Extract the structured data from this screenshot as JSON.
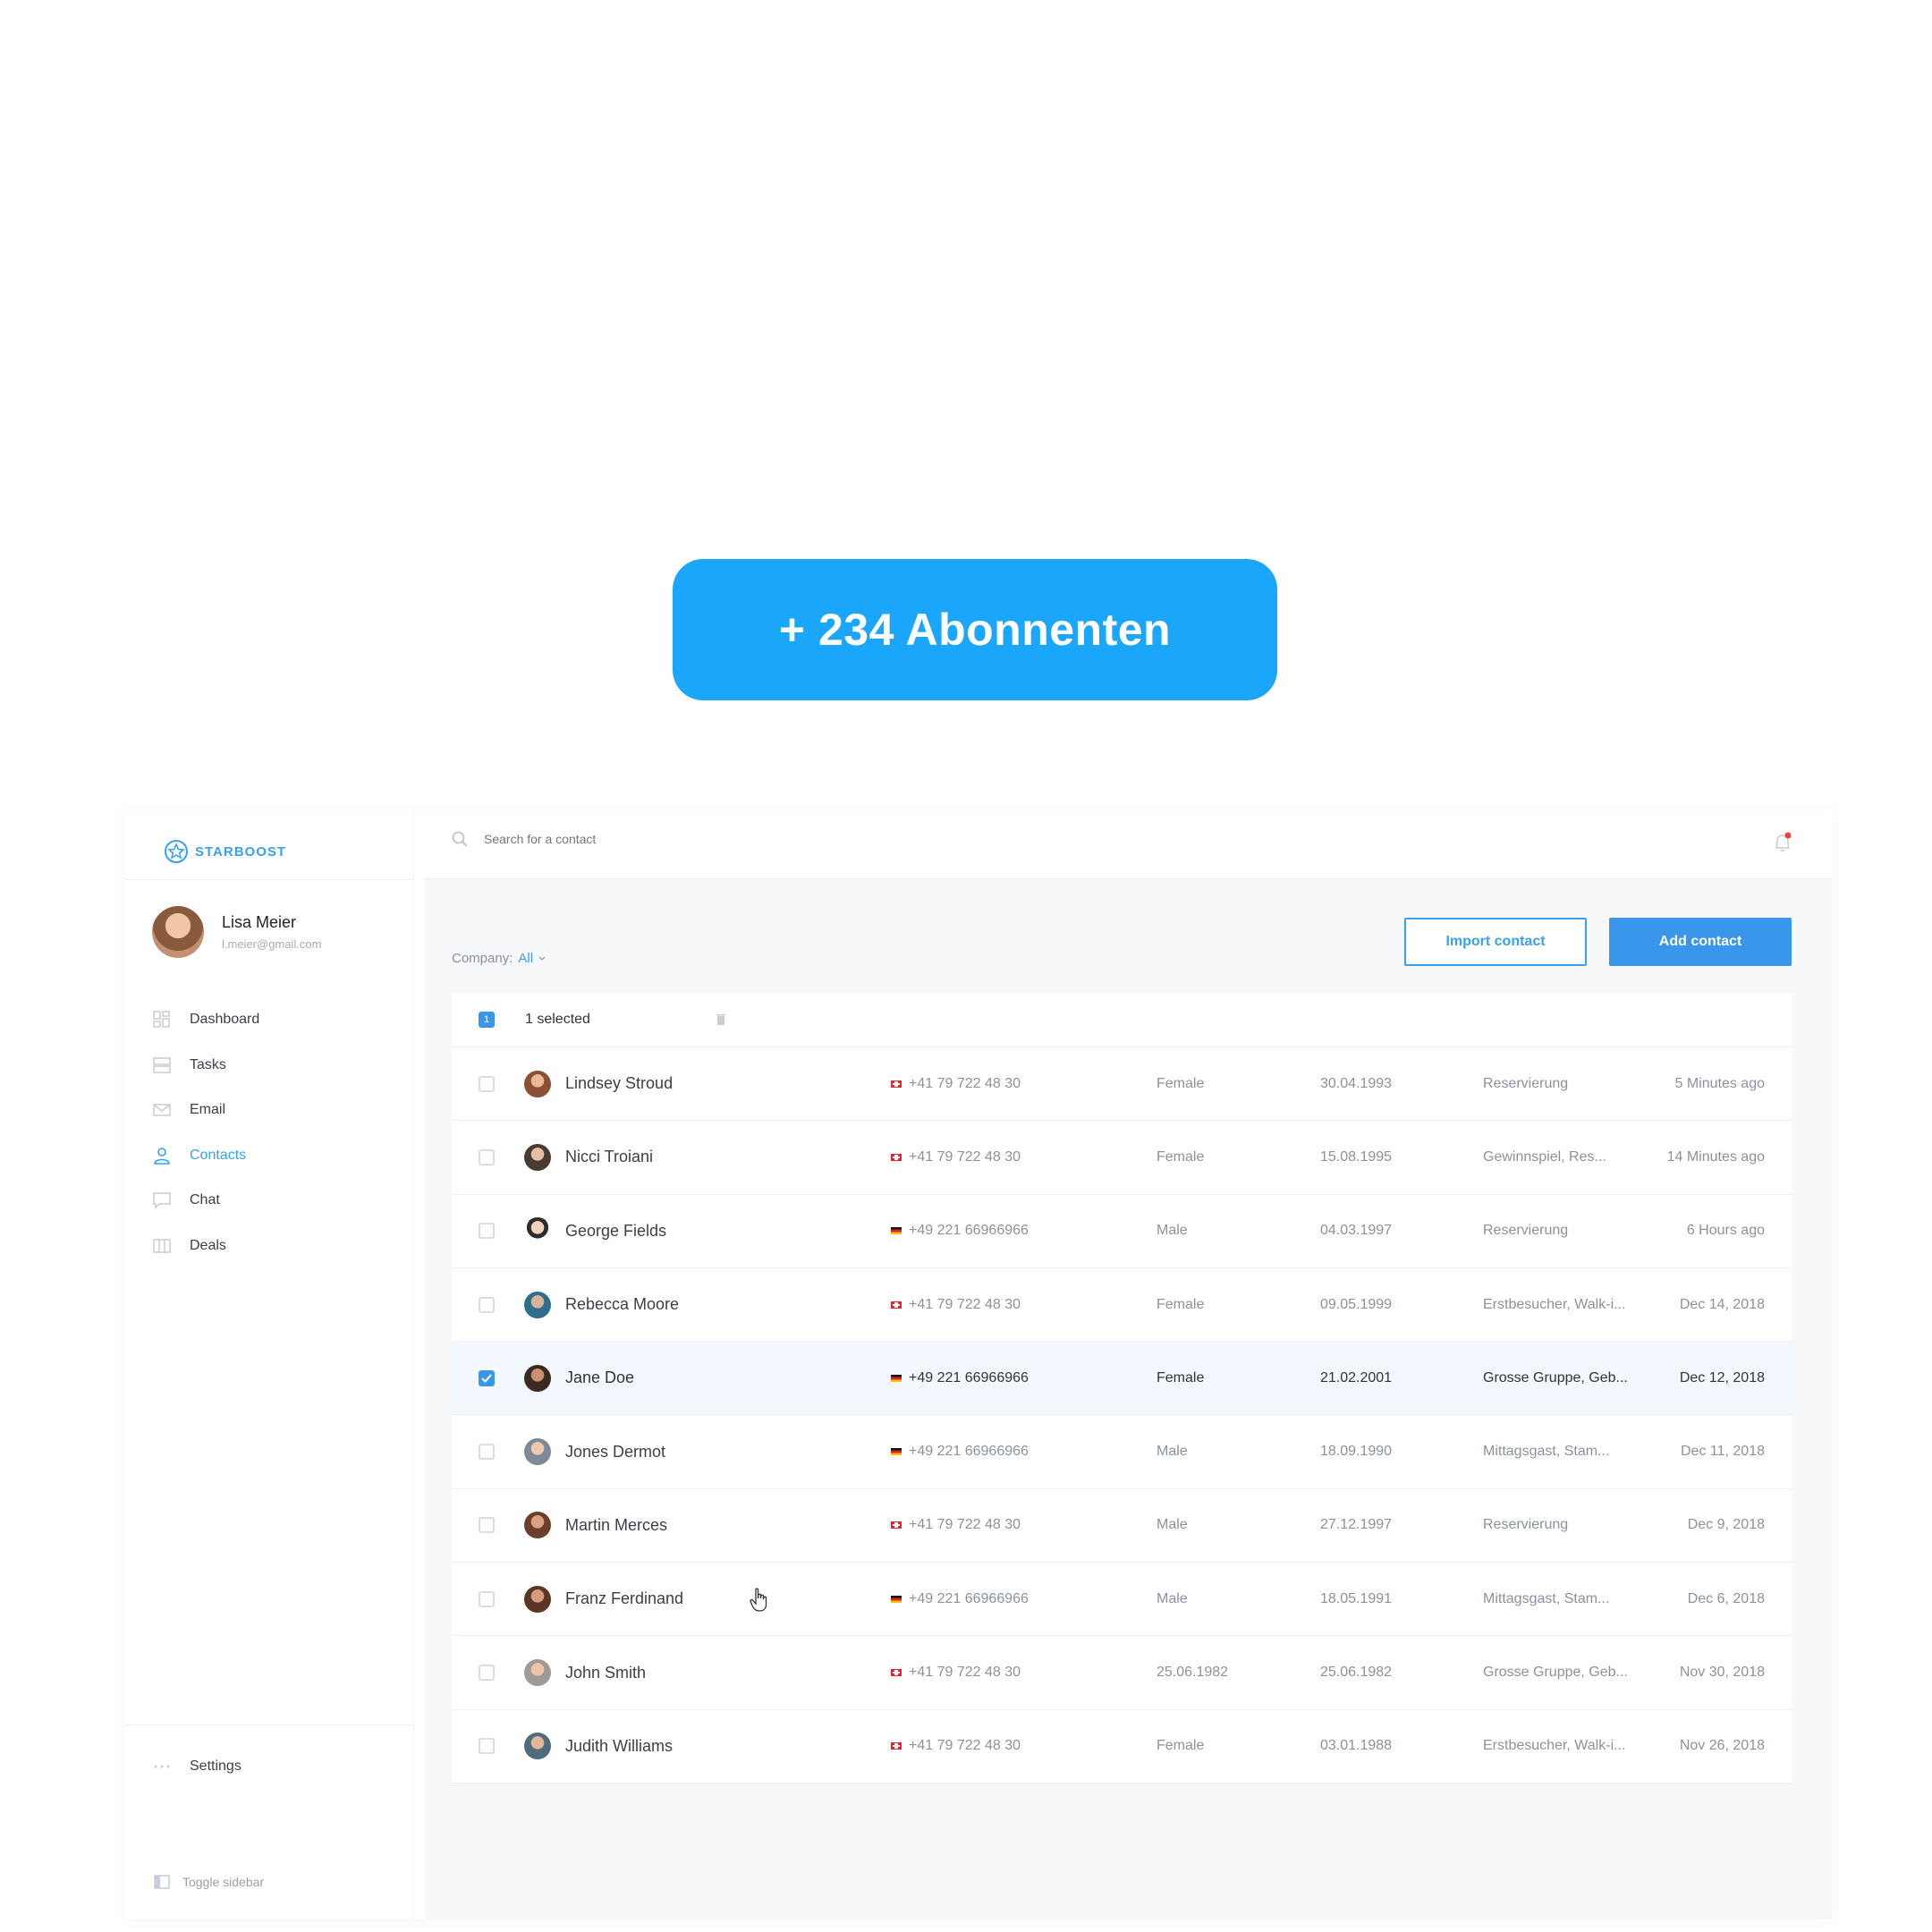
{
  "banner": {
    "text": "+ 234 Abonnenten"
  },
  "brand": {
    "name": "STARBOOST"
  },
  "user": {
    "name": "Lisa Meier",
    "email": "l.meier@gmail.com"
  },
  "nav": [
    {
      "label": "Dashboard",
      "icon": "dashboard-icon"
    },
    {
      "label": "Tasks",
      "icon": "tasks-icon"
    },
    {
      "label": "Email",
      "icon": "email-icon"
    },
    {
      "label": "Contacts",
      "icon": "user-icon",
      "active": true
    },
    {
      "label": "Chat",
      "icon": "chat-icon"
    },
    {
      "label": "Deals",
      "icon": "deals-icon"
    }
  ],
  "settings": {
    "label": "Settings"
  },
  "toggle_sidebar": {
    "label": "Toggle sidebar"
  },
  "search": {
    "placeholder": "Search for a contact"
  },
  "filter": {
    "label": "Company:",
    "value": "All"
  },
  "buttons": {
    "import": "Import contact",
    "add": "Add contact"
  },
  "selection": {
    "count": "1",
    "label": "1 selected"
  },
  "accent_color": "#3a96ea",
  "contacts": [
    {
      "name": "Lindsey Stroud",
      "flag": "ch",
      "phone": "+41 79 722 48 30",
      "gender": "Female",
      "birthdate": "30.04.1993",
      "tags": "Reservierung",
      "time": "5 Minutes ago",
      "checked": false
    },
    {
      "name": "Nicci Troiani",
      "flag": "ch",
      "phone": "+41 79 722 48 30",
      "gender": "Female",
      "birthdate": "15.08.1995",
      "tags": "Gewinnspiel, Res...",
      "time": "14 Minutes ago",
      "checked": false
    },
    {
      "name": "George Fields",
      "flag": "de",
      "phone": "+49 221 66966966",
      "gender": "Male",
      "birthdate": "04.03.1997",
      "tags": "Reservierung",
      "time": "6 Hours ago",
      "checked": false
    },
    {
      "name": "Rebecca Moore",
      "flag": "ch",
      "phone": "+41 79 722 48 30",
      "gender": "Female",
      "birthdate": "09.05.1999",
      "tags": "Erstbesucher, Walk-i...",
      "time": "Dec 14, 2018",
      "checked": false
    },
    {
      "name": "Jane Doe",
      "flag": "de",
      "phone": "+49 221 66966966",
      "gender": "Female",
      "birthdate": "21.02.2001",
      "tags": "Grosse Gruppe, Geb...",
      "time": "Dec 12, 2018",
      "checked": true
    },
    {
      "name": "Jones Dermot",
      "flag": "de",
      "phone": "+49 221 66966966",
      "gender": "Male",
      "birthdate": "18.09.1990",
      "tags": "Mittagsgast, Stam...",
      "time": "Dec 11, 2018",
      "checked": false
    },
    {
      "name": "Martin Merces",
      "flag": "ch",
      "phone": "+41 79 722 48 30",
      "gender": "Male",
      "birthdate": "27.12.1997",
      "tags": "Reservierung",
      "time": "Dec 9, 2018",
      "checked": false
    },
    {
      "name": "Franz Ferdinand",
      "flag": "de",
      "phone": "+49 221 66966966",
      "gender": "Male",
      "birthdate": "18.05.1991",
      "tags": "Mittagsgast, Stam...",
      "time": "Dec 6, 2018",
      "checked": false
    },
    {
      "name": "John Smith",
      "flag": "ch",
      "phone": "+41 79 722 48 30",
      "gender": "25.06.1982",
      "birthdate": "25.06.1982",
      "tags": "Grosse Gruppe, Geb...",
      "time": "Nov 30, 2018",
      "checked": false
    },
    {
      "name": "Judith Williams",
      "flag": "ch",
      "phone": "+41 79 722 48 30",
      "gender": "Female",
      "birthdate": "03.01.1988",
      "tags": "Erstbesucher, Walk-i...",
      "time": "Nov 26, 2018",
      "checked": false
    }
  ]
}
